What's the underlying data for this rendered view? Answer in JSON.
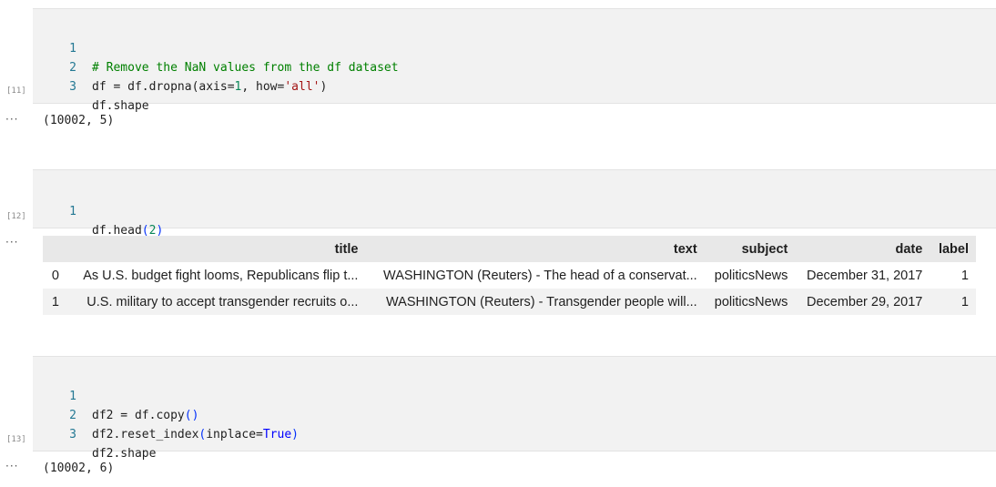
{
  "cells": [
    {
      "exec_count": "[11]",
      "lines": [
        {
          "num": "1",
          "comment": "# Remove the NaN values from the df dataset"
        },
        {
          "num": "2",
          "t1": "df = df.dropna(axis=",
          "n1": "1",
          "t2": ", how=",
          "s1": "'all'",
          "t3": ")"
        },
        {
          "num": "3",
          "t1": "df.shape"
        }
      ],
      "output": "(10002, 5)"
    },
    {
      "exec_count": "[12]",
      "lines": [
        {
          "num": "1",
          "t1": "df.head",
          "p1": "(",
          "n1": "2",
          "p2": ")"
        }
      ]
    },
    {
      "exec_count": "[13]",
      "lines": [
        {
          "num": "1",
          "t1": "df2 = df.copy",
          "p1": "()"
        },
        {
          "num": "2",
          "t1": "df2.reset_index",
          "p1": "(",
          "t2": "inplace=",
          "k1": "True",
          "p2": ")"
        },
        {
          "num": "3",
          "t1": "df2.shape"
        }
      ],
      "output": "(10002, 6)"
    }
  ],
  "output_menu": "···",
  "dataframe": {
    "columns": [
      "",
      "title",
      "text",
      "subject",
      "date",
      "label"
    ],
    "rows": [
      [
        "0",
        "As U.S. budget fight looms, Republicans flip t...",
        "WASHINGTON (Reuters) - The head of a conservat...",
        "politicsNews",
        "December 31, 2017",
        "1"
      ],
      [
        "1",
        "U.S. military to accept transgender recruits o...",
        "WASHINGTON (Reuters) - Transgender people will...",
        "politicsNews",
        "December 29, 2017",
        "1"
      ]
    ]
  }
}
